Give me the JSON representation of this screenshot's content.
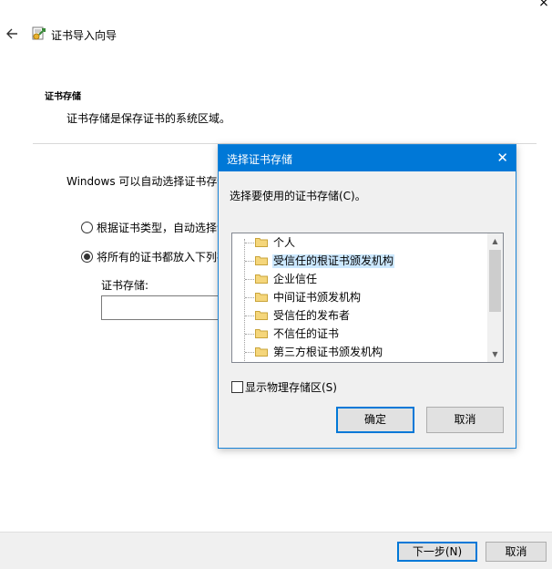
{
  "wizard": {
    "title": "证书导入向导",
    "close_glyph": "×",
    "section_title": "证书存储",
    "section_desc": "证书存储是保存证书的系统区域。",
    "auto_text": "Windows 可以自动选择证书存储，或者你可以为证书指定一个位置。",
    "option1_label": "根据证书类型，自动选择证书存储(U)",
    "option2_label": "将所有的证书都放入下列存储(P)",
    "option2_selected": true,
    "store_label": "证书存储:",
    "store_value": "",
    "next_button": "下一步(N)",
    "cancel_button": "取消"
  },
  "dialog": {
    "title": "选择证书存储",
    "close_glyph": "✕",
    "prompt": "选择要使用的证书存储(C)。",
    "items": [
      {
        "label": "个人",
        "selected": false
      },
      {
        "label": "受信任的根证书颁发机构",
        "selected": true
      },
      {
        "label": "企业信任",
        "selected": false
      },
      {
        "label": "中间证书颁发机构",
        "selected": false
      },
      {
        "label": "受信任的发布者",
        "selected": false
      },
      {
        "label": "不信任的证书",
        "selected": false
      },
      {
        "label": "第三方根证书颁发机构",
        "selected": false
      }
    ],
    "show_physical_label": "显示物理存储区(S)",
    "show_physical_checked": false,
    "ok_button": "确定",
    "cancel_button": "取消"
  },
  "colors": {
    "accent": "#0078d7",
    "selection": "#cce8ff",
    "folder": "#f5d67b"
  }
}
